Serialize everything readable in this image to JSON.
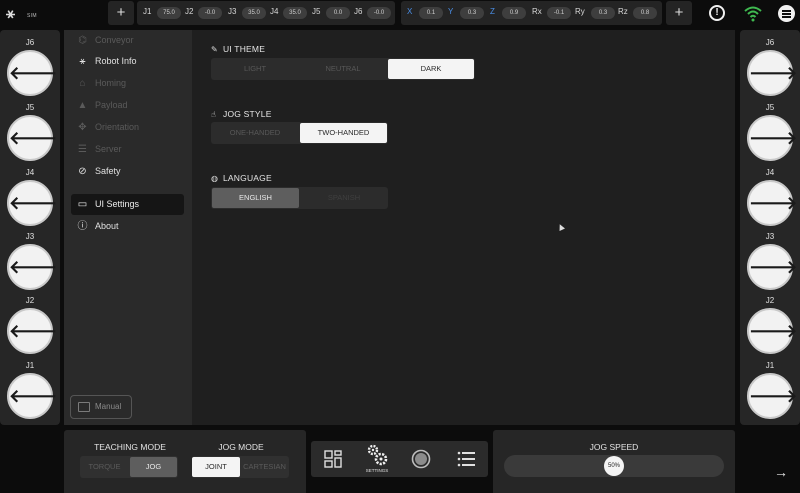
{
  "top_bar": {
    "logo_text": "SIM",
    "add_left_label": "+",
    "add_right_label": "+",
    "joints": [
      {
        "label": "J1",
        "value": "75.0"
      },
      {
        "label": "J2",
        "value": "-0.0"
      },
      {
        "label": "J3",
        "value": "35.0"
      },
      {
        "label": "J4",
        "value": "35.0"
      },
      {
        "label": "J5",
        "value": "0.0"
      },
      {
        "label": "J6",
        "value": "-0.0"
      }
    ],
    "cartesian": [
      {
        "label": "X",
        "value": "0.1"
      },
      {
        "label": "Y",
        "value": "0.3"
      },
      {
        "label": "Z",
        "value": "0.9"
      },
      {
        "label": "Rx",
        "value": "-0.1"
      },
      {
        "label": "Ry",
        "value": "0.3"
      },
      {
        "label": "Rz",
        "value": "0.8"
      }
    ],
    "alert_icon": "!",
    "axis_color": "#4a8fe8",
    "wifi_color": "#3fb950"
  },
  "jog_left": {
    "items": [
      {
        "label": "J6",
        "arrow": "🡐"
      },
      {
        "label": "J5",
        "arrow": "🡐"
      },
      {
        "label": "J4",
        "arrow": "🡐"
      },
      {
        "label": "J3",
        "arrow": "🡐"
      },
      {
        "label": "J2",
        "arrow": "🡐"
      },
      {
        "label": "J1",
        "arrow": "🡐"
      }
    ]
  },
  "jog_right": {
    "items": [
      {
        "label": "J6",
        "arrow": "🡒"
      },
      {
        "label": "J5",
        "arrow": "🡒"
      },
      {
        "label": "J4",
        "arrow": "🡒"
      },
      {
        "label": "J3",
        "arrow": "🡒"
      },
      {
        "label": "J2",
        "arrow": "🡒"
      },
      {
        "label": "J1",
        "arrow": "🡒"
      }
    ]
  },
  "sidebar": {
    "items": [
      {
        "label": "Conveyor",
        "icon": "conveyor-icon",
        "state": "disabled"
      },
      {
        "label": "Robot Info",
        "icon": "robot-icon",
        "state": "enabled"
      },
      {
        "label": "Homing",
        "icon": "home-icon",
        "state": "disabled"
      },
      {
        "label": "Payload",
        "icon": "payload-icon",
        "state": "disabled"
      },
      {
        "label": "Orientation",
        "icon": "orientation-icon",
        "state": "disabled"
      },
      {
        "label": "Server",
        "icon": "server-icon",
        "state": "disabled"
      },
      {
        "label": "Safety",
        "icon": "safety-icon",
        "state": "enabled"
      },
      {
        "label": "UI Settings",
        "icon": "ui-settings-icon",
        "state": "active"
      },
      {
        "label": "About",
        "icon": "info-icon",
        "state": "enabled"
      }
    ],
    "manual_label": "Manual"
  },
  "settings": {
    "ui_theme": {
      "title": "UI THEME",
      "options": [
        "LIGHT",
        "NEUTRAL",
        "DARK"
      ],
      "selected": "DARK"
    },
    "jog_style": {
      "title": "JOG STYLE",
      "options": [
        "ONE-HANDED",
        "TWO-HANDED"
      ],
      "selected": "TWO-HANDED"
    },
    "language": {
      "title": "LANGUAGE",
      "options": [
        "ENGLISH",
        "SPANISH"
      ],
      "selected": "ENGLISH"
    }
  },
  "bottom": {
    "teaching_mode": {
      "title": "TEACHING MODE",
      "options": [
        "TORQUE",
        "JOG"
      ],
      "selected": "JOG"
    },
    "jog_mode": {
      "title": "JOG MODE",
      "options": [
        "JOINT",
        "CARTESIAN"
      ],
      "selected": "JOINT"
    },
    "nav": {
      "settings_label": "SETTINGS"
    },
    "jog_speed": {
      "title": "JOG SPEED",
      "value_label": "50%",
      "fraction": 0.5
    },
    "next_arrow": "→"
  }
}
